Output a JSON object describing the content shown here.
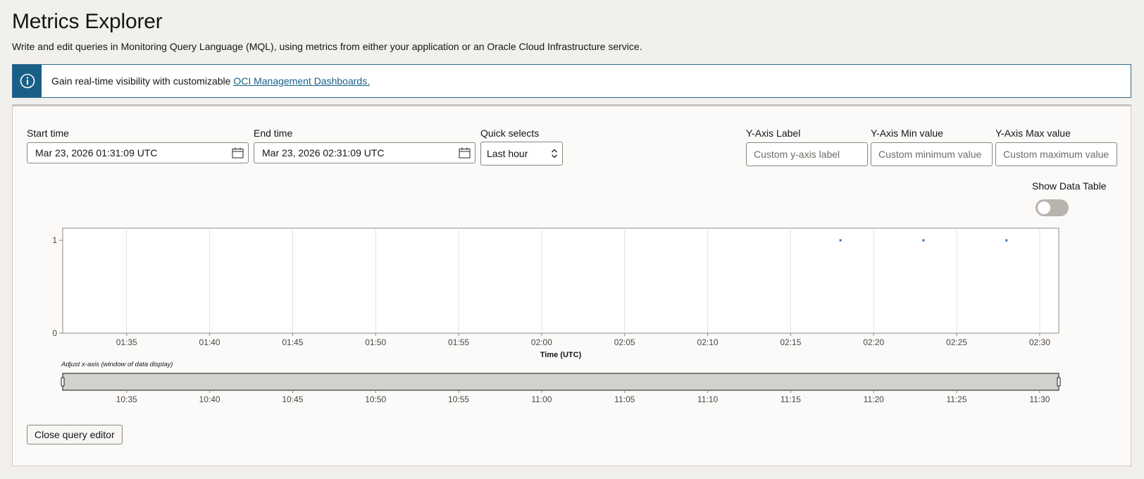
{
  "header": {
    "title": "Metrics Explorer",
    "subtitle": "Write and edit queries in Monitoring Query Language (MQL), using metrics from either your application or an Oracle Cloud Infrastructure service."
  },
  "banner": {
    "text": "Gain real-time visibility with customizable ",
    "link": "OCI Management Dashboards.",
    "icon": "info-icon"
  },
  "controls": {
    "start_label": "Start time",
    "start_value": "Mar 23, 2026 01:31:09 UTC",
    "end_label": "End time",
    "end_value": "Mar 23, 2026 02:31:09 UTC",
    "quick_label": "Quick selects",
    "quick_value": "Last hour",
    "y_label_label": "Y-Axis Label",
    "y_label_placeholder": "Custom y-axis label",
    "y_min_label": "Y-Axis Min value",
    "y_min_placeholder": "Custom minimum value",
    "y_max_label": "Y-Axis Max value",
    "y_max_placeholder": "Custom maximum value",
    "show_table_label": "Show Data Table",
    "show_table_on": false,
    "close_button": "Close query editor"
  },
  "colors": {
    "accent": "#1a5f86",
    "series": "#2f6db5"
  },
  "chart_data": {
    "type": "scatter",
    "x_tick_labels": [
      "01:35",
      "01:40",
      "01:45",
      "01:50",
      "01:55",
      "02:00",
      "02:05",
      "02:10",
      "02:15",
      "02:20",
      "02:25",
      "02:30"
    ],
    "y_tick_labels": [
      "0",
      "1"
    ],
    "xlabel": "Time (UTC)",
    "ylabel": "",
    "xlim": [
      "01:31:09",
      "02:31:09"
    ],
    "ylim": [
      0,
      1.13
    ],
    "grid": true,
    "series": [
      {
        "x": [
          "02:18",
          "02:23",
          "02:28"
        ],
        "y": [
          1,
          1,
          1
        ]
      }
    ],
    "range_selector": {
      "label": "Adjust x-axis (window of data display)",
      "tick_labels": [
        "10:35",
        "10:40",
        "10:45",
        "10:50",
        "10:55",
        "11:00",
        "11:05",
        "11:10",
        "11:15",
        "11:20",
        "11:25",
        "11:30"
      ]
    }
  }
}
